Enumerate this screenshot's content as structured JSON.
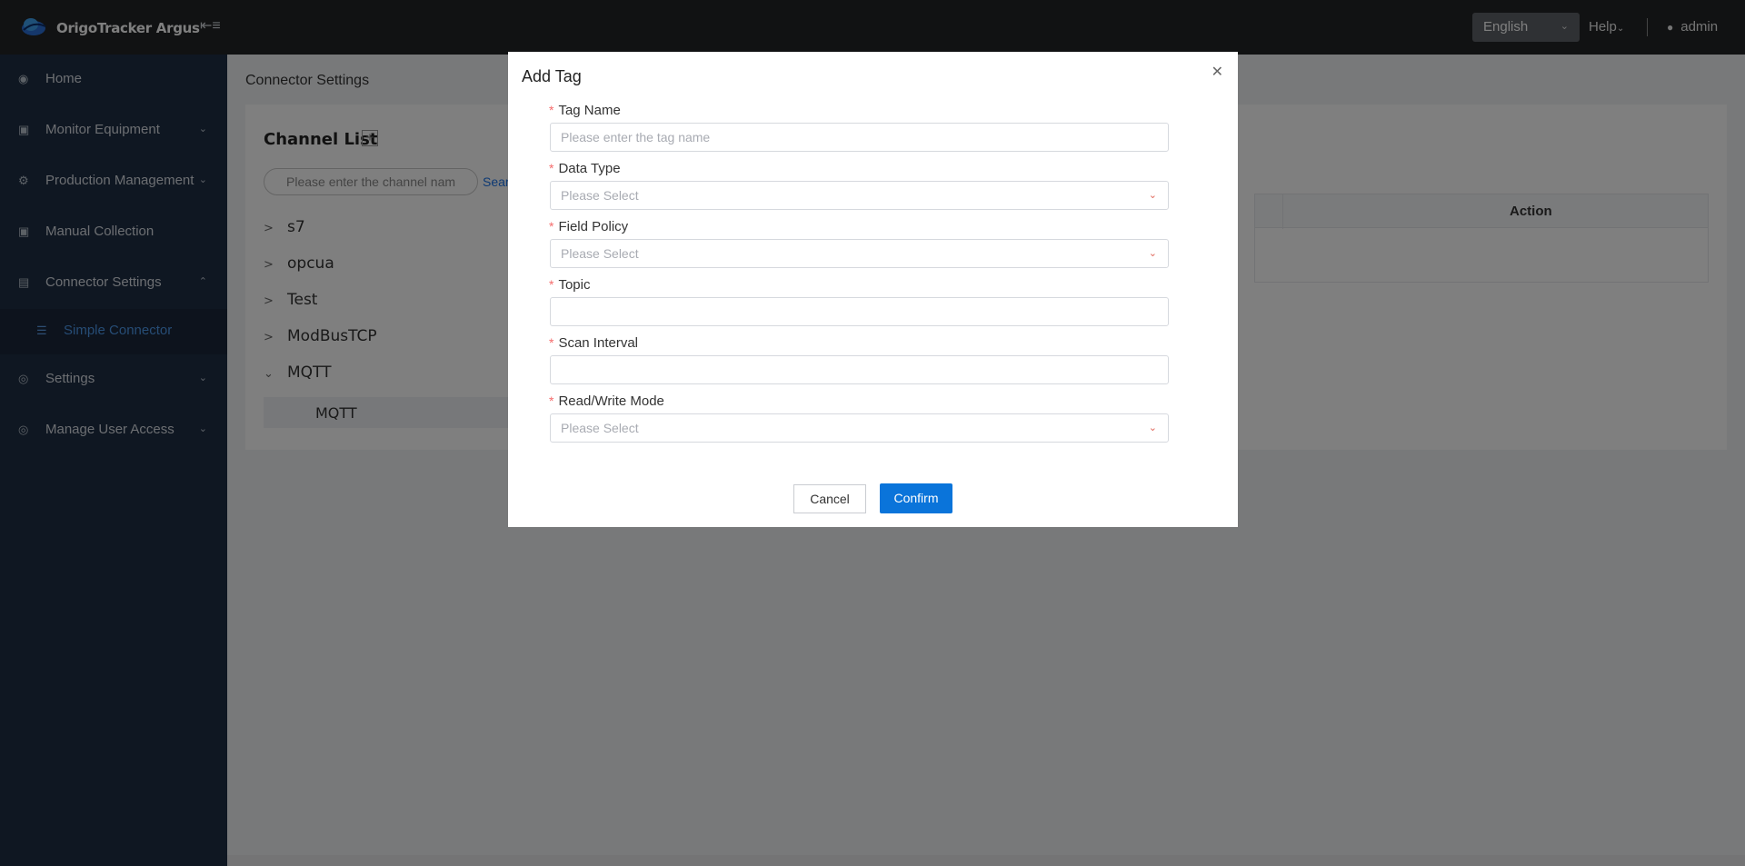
{
  "header": {
    "app_title": "OrigoTracker Argus",
    "language": "English",
    "help": "Help",
    "user": "admin"
  },
  "sidebar": {
    "items": [
      {
        "label": "Home",
        "icon": "dashboard-icon"
      },
      {
        "label": "Monitor Equipment",
        "icon": "monitor-icon"
      },
      {
        "label": "Production Management",
        "icon": "gear-icon"
      },
      {
        "label": "Manual Collection",
        "icon": "monitor-icon"
      },
      {
        "label": "Connector Settings",
        "icon": "document-icon"
      },
      {
        "label": "Simple Connector",
        "icon": "server-icon"
      },
      {
        "label": "Settings",
        "icon": "settings-icon"
      },
      {
        "label": "Manage User Access",
        "icon": "settings-icon"
      }
    ]
  },
  "page": {
    "title": "Connector Settings",
    "channel_list_title": "Channel List",
    "channel_search_placeholder": "Please enter the channel nam",
    "search_link": "Sear",
    "tree": [
      "s7",
      "opcua",
      "Test",
      "ModBusTCP",
      "MQTT"
    ],
    "tree_child": "MQTT",
    "table_action_header": "Action"
  },
  "modal": {
    "title": "Add Tag",
    "fields": {
      "tag_name": {
        "label": "Tag Name",
        "placeholder": "Please enter the tag name"
      },
      "data_type": {
        "label": "Data Type",
        "placeholder": "Please Select"
      },
      "field_policy": {
        "label": "Field Policy",
        "placeholder": "Please Select"
      },
      "topic": {
        "label": "Topic",
        "value": ""
      },
      "scan_interval": {
        "label": "Scan Interval",
        "value": ""
      },
      "rw_mode": {
        "label": "Read/Write Mode",
        "placeholder": "Please Select"
      }
    },
    "required_mark": "*",
    "cancel": "Cancel",
    "confirm": "Confirm"
  },
  "colors": {
    "header_bg": "#222427",
    "sidebar_bg": "#1f2f44",
    "accent": "#0a74da",
    "required": "#f56c6c"
  }
}
